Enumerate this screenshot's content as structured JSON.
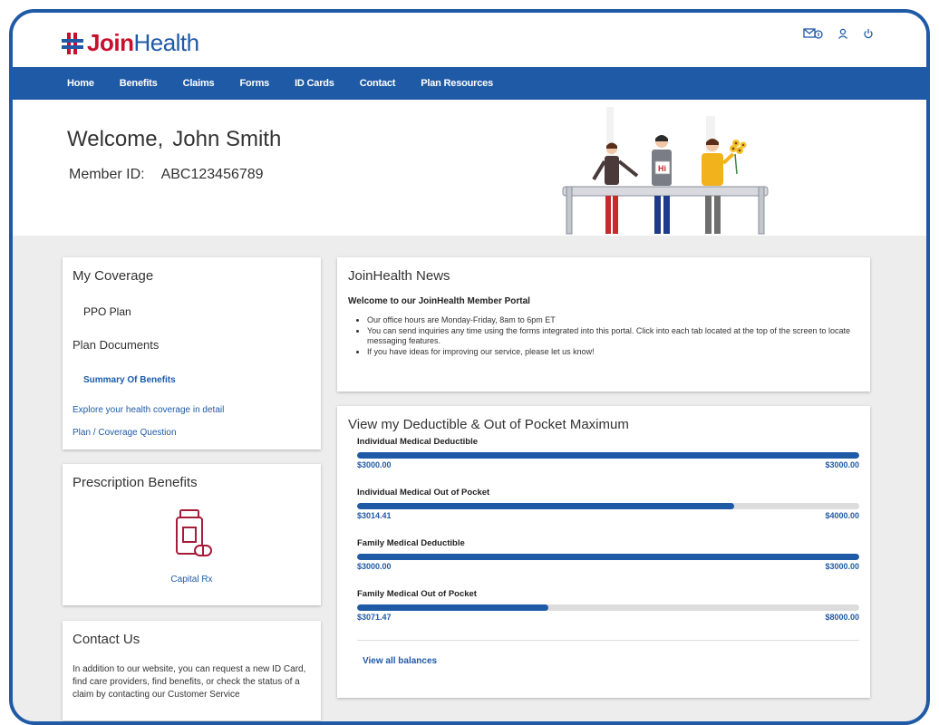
{
  "brand": {
    "logo_part1": "Join",
    "logo_part2": "Health"
  },
  "top_icons": [
    "mail-icon",
    "user-icon",
    "power-icon"
  ],
  "nav": {
    "items": [
      "Home",
      "Benefits",
      "Claims",
      "Forms",
      "ID Cards",
      "Contact",
      "Plan Resources"
    ]
  },
  "hero": {
    "welcome_label": "Welcome,",
    "name": "John Smith",
    "member_label": "Member ID:",
    "member_id": "ABC123456789",
    "sign_text": "Hi"
  },
  "coverage": {
    "title": "My Coverage",
    "plan": "PPO Plan",
    "docs_title": "Plan Documents",
    "summary_link": "Summary Of Benefits",
    "explore_link": "Explore your health coverage in detail",
    "question_link": "Plan / Coverage Question"
  },
  "rx": {
    "title": "Prescription Benefits",
    "provider": "Capital Rx"
  },
  "contact": {
    "title": "Contact Us",
    "text": "In addition to our website, you can request a new ID Card, find care providers, find benefits, or check the status of a claim by contacting our Customer Service"
  },
  "news": {
    "title": "JoinHealth News",
    "subtitle": "Welcome to our JoinHealth Member Portal",
    "items": [
      "Our office hours are Monday-Friday, 8am to 6pm ET",
      "You can send inquiries any time using the forms integrated into this portal. Click into each tab located at the top of the screen to locate messaging features.",
      "If you have ideas for improving our service, please let us know!"
    ]
  },
  "deductible": {
    "title": "View my Deductible & Out of Pocket Maximum",
    "bars": [
      {
        "label": "Individual Medical Deductible",
        "current": "$3000.00",
        "max": "$3000.00",
        "fraction": 1.0
      },
      {
        "label": "Individual Medical Out of Pocket",
        "current": "$3014.41",
        "max": "$4000.00",
        "fraction": 0.75
      },
      {
        "label": "Family Medical Deductible",
        "current": "$3000.00",
        "max": "$3000.00",
        "fraction": 1.0
      },
      {
        "label": "Family Medical Out of Pocket",
        "current": "$3071.47",
        "max": "$8000.00",
        "fraction": 0.38
      }
    ],
    "view_all": "View all balances"
  },
  "colors": {
    "brand_blue": "#1f5aa6",
    "brand_red": "#c8102e"
  }
}
